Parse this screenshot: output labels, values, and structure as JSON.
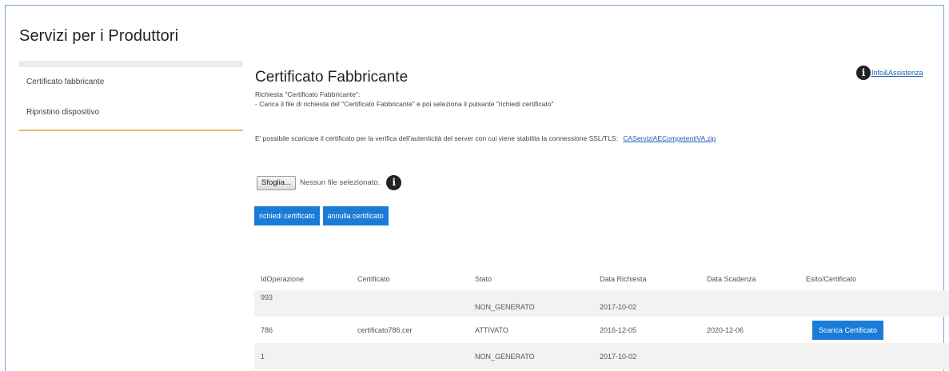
{
  "app": {
    "title": "Servizi per i Produttori"
  },
  "sidebar": {
    "items": [
      {
        "label": "Certificato fabbricante"
      },
      {
        "label": "Ripristino dispositivo"
      }
    ]
  },
  "main": {
    "title": "Certificato Fabbricante",
    "info_link": "Info&Assistenza",
    "instructions": [
      "Richiesta \"Certificato Fabbricante\":",
      "- Carica il file di richiesta del \"Certificato Fabbricante\" e poi seleziona il pulsante \"richiedi certificato\""
    ],
    "ssl_text": "E' possibile scaricare il certificato per la verifica dell'autenticità del server con cui viene stabilita la connessione SSL/TLS:",
    "ssl_link": "CAServiziAECompetentiVA.zip",
    "file": {
      "button_label": "Sfoglia...",
      "status": "Nessun file selezionato."
    },
    "buttons": {
      "request": "richiedi certificato",
      "cancel": "annulla certificato"
    }
  },
  "table": {
    "headers": [
      "IdOperazione",
      "Certificato",
      "Stato",
      "Data Richiesta",
      "Data Scadenza",
      "Esito/Certificato"
    ],
    "rows": [
      {
        "id": "993",
        "cert": "",
        "stato": "NON_GENERATO",
        "data_richiesta": "2017-10-02",
        "data_scadenza": "",
        "esito": ""
      },
      {
        "id": "786",
        "cert": "certificato786.cer",
        "stato": "ATTIVATO",
        "data_richiesta": "2016-12-05",
        "data_scadenza": "2020-12-06",
        "esito": "Scarica Certificato"
      },
      {
        "id": "1",
        "cert": "",
        "stato": "NON_GENERATO",
        "data_richiesta": "2017-10-02",
        "data_scadenza": "",
        "esito": ""
      }
    ]
  },
  "colors": {
    "accent_blue": "#1a7cd6",
    "sidebar_rule": "#e8b96a",
    "frame_border": "#7b9fd1"
  }
}
